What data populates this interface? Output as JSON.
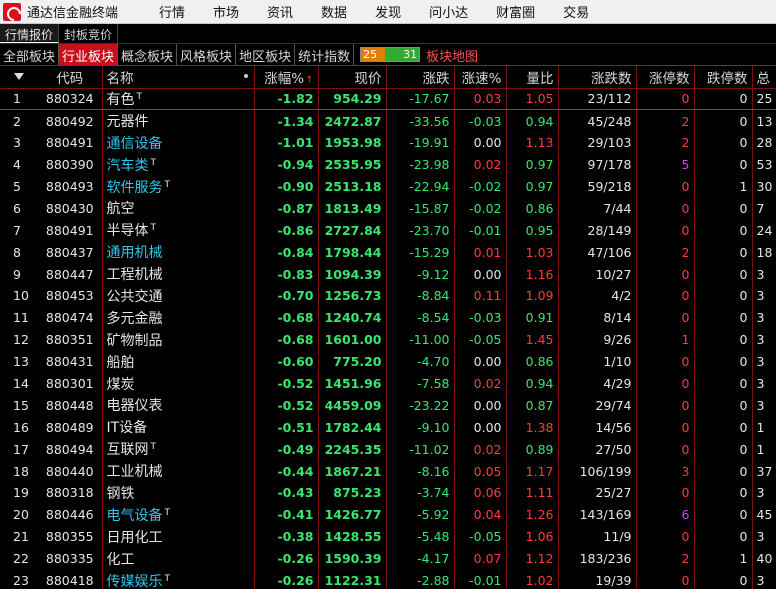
{
  "app": {
    "title": "通达信金融终端"
  },
  "menu": [
    "行情",
    "市场",
    "资讯",
    "数据",
    "发现",
    "问小达",
    "财富圈",
    "交易"
  ],
  "subtabs": [
    "行情报价",
    "封板竞价"
  ],
  "category_tabs": [
    "全部板块",
    "行业板块",
    "概念板块",
    "风格板块",
    "地区板块",
    "统计指数"
  ],
  "breadth": {
    "up": "25",
    "down": "31"
  },
  "map_button": "板块地图",
  "columns": {
    "code": "代码",
    "name": "名称",
    "pct": "涨幅%",
    "price": "现价",
    "chg": "涨跌",
    "speed": "涨速%",
    "ratio": "量比",
    "updown": "涨跌数",
    "limitup": "涨停数",
    "limitdown": "跌停数",
    "extra": "总"
  },
  "rows": [
    {
      "idx": "1",
      "code": "880324",
      "name": "有色",
      "tag": "T",
      "link": false,
      "pct": "-1.82",
      "price": "954.29",
      "chg": "-17.67",
      "speed": "0.03",
      "ratio": "1.05",
      "updown": "23/112",
      "limitup": "0",
      "limitdown": "0",
      "extra": "25"
    },
    {
      "idx": "2",
      "code": "880492",
      "name": "元器件",
      "tag": "",
      "link": false,
      "pct": "-1.34",
      "price": "2472.87",
      "chg": "-33.56",
      "speed": "-0.03",
      "ratio": "0.94",
      "updown": "45/248",
      "limitup": "2",
      "limitdown": "0",
      "extra": "13"
    },
    {
      "idx": "3",
      "code": "880491",
      "name": "通信设备",
      "tag": "",
      "link": true,
      "pct": "-1.01",
      "price": "1953.98",
      "chg": "-19.91",
      "speed": "0.00",
      "ratio": "1.13",
      "updown": "29/103",
      "limitup": "2",
      "limitdown": "0",
      "extra": "28"
    },
    {
      "idx": "4",
      "code": "880390",
      "name": "汽车类",
      "tag": "T",
      "link": true,
      "pct": "-0.94",
      "price": "2535.95",
      "chg": "-23.98",
      "speed": "0.02",
      "ratio": "0.97",
      "updown": "97/178",
      "limitup": "5",
      "limitdown": "0",
      "extra": "53"
    },
    {
      "idx": "5",
      "code": "880493",
      "name": "软件服务",
      "tag": "T",
      "link": true,
      "pct": "-0.90",
      "price": "2513.18",
      "chg": "-22.94",
      "speed": "-0.02",
      "ratio": "0.97",
      "updown": "59/218",
      "limitup": "0",
      "limitdown": "1",
      "extra": "30"
    },
    {
      "idx": "6",
      "code": "880430",
      "name": "航空",
      "tag": "",
      "link": false,
      "pct": "-0.87",
      "price": "1813.49",
      "chg": "-15.87",
      "speed": "-0.02",
      "ratio": "0.86",
      "updown": "7/44",
      "limitup": "0",
      "limitdown": "0",
      "extra": "7"
    },
    {
      "idx": "7",
      "code": "880491",
      "name": "半导体",
      "tag": "T",
      "link": false,
      "pct": "-0.86",
      "price": "2727.84",
      "chg": "-23.70",
      "speed": "-0.01",
      "ratio": "0.95",
      "updown": "28/149",
      "limitup": "0",
      "limitdown": "0",
      "extra": "24"
    },
    {
      "idx": "8",
      "code": "880437",
      "name": "通用机械",
      "tag": "",
      "link": true,
      "pct": "-0.84",
      "price": "1798.44",
      "chg": "-15.29",
      "speed": "0.01",
      "ratio": "1.03",
      "updown": "47/106",
      "limitup": "2",
      "limitdown": "0",
      "extra": "18"
    },
    {
      "idx": "9",
      "code": "880447",
      "name": "工程机械",
      "tag": "",
      "link": false,
      "pct": "-0.83",
      "price": "1094.39",
      "chg": "-9.12",
      "speed": "0.00",
      "ratio": "1.16",
      "updown": "10/27",
      "limitup": "0",
      "limitdown": "0",
      "extra": "3"
    },
    {
      "idx": "10",
      "code": "880453",
      "name": "公共交通",
      "tag": "",
      "link": false,
      "pct": "-0.70",
      "price": "1256.73",
      "chg": "-8.84",
      "speed": "0.11",
      "ratio": "1.09",
      "updown": "4/2",
      "limitup": "0",
      "limitdown": "0",
      "extra": "3"
    },
    {
      "idx": "11",
      "code": "880474",
      "name": "多元金融",
      "tag": "",
      "link": false,
      "pct": "-0.68",
      "price": "1240.74",
      "chg": "-8.54",
      "speed": "-0.03",
      "ratio": "0.91",
      "updown": "8/14",
      "limitup": "0",
      "limitdown": "0",
      "extra": "3"
    },
    {
      "idx": "12",
      "code": "880351",
      "name": "矿物制品",
      "tag": "",
      "link": false,
      "pct": "-0.68",
      "price": "1601.00",
      "chg": "-11.00",
      "speed": "-0.05",
      "ratio": "1.45",
      "updown": "9/26",
      "limitup": "1",
      "limitdown": "0",
      "extra": "3"
    },
    {
      "idx": "13",
      "code": "880431",
      "name": "船舶",
      "tag": "",
      "link": false,
      "pct": "-0.60",
      "price": "775.20",
      "chg": "-4.70",
      "speed": "0.00",
      "ratio": "0.86",
      "updown": "1/10",
      "limitup": "0",
      "limitdown": "0",
      "extra": "3"
    },
    {
      "idx": "14",
      "code": "880301",
      "name": "煤炭",
      "tag": "",
      "link": false,
      "pct": "-0.52",
      "price": "1451.96",
      "chg": "-7.58",
      "speed": "0.02",
      "ratio": "0.94",
      "updown": "4/29",
      "limitup": "0",
      "limitdown": "0",
      "extra": "3"
    },
    {
      "idx": "15",
      "code": "880448",
      "name": "电器仪表",
      "tag": "",
      "link": false,
      "pct": "-0.52",
      "price": "4459.09",
      "chg": "-23.22",
      "speed": "0.00",
      "ratio": "0.87",
      "updown": "29/74",
      "limitup": "0",
      "limitdown": "0",
      "extra": "3"
    },
    {
      "idx": "16",
      "code": "880489",
      "name": "IT设备",
      "tag": "",
      "link": false,
      "pct": "-0.51",
      "price": "1782.44",
      "chg": "-9.10",
      "speed": "0.00",
      "ratio": "1.38",
      "updown": "14/56",
      "limitup": "0",
      "limitdown": "0",
      "extra": "1"
    },
    {
      "idx": "17",
      "code": "880494",
      "name": "互联网",
      "tag": "T",
      "link": false,
      "pct": "-0.49",
      "price": "2245.35",
      "chg": "-11.02",
      "speed": "0.02",
      "ratio": "0.89",
      "updown": "27/50",
      "limitup": "0",
      "limitdown": "0",
      "extra": "1"
    },
    {
      "idx": "18",
      "code": "880440",
      "name": "工业机械",
      "tag": "",
      "link": false,
      "pct": "-0.44",
      "price": "1867.21",
      "chg": "-8.16",
      "speed": "0.05",
      "ratio": "1.17",
      "updown": "106/199",
      "limitup": "3",
      "limitdown": "0",
      "extra": "37"
    },
    {
      "idx": "19",
      "code": "880318",
      "name": "钢铁",
      "tag": "",
      "link": false,
      "pct": "-0.43",
      "price": "875.23",
      "chg": "-3.74",
      "speed": "0.06",
      "ratio": "1.11",
      "updown": "25/27",
      "limitup": "0",
      "limitdown": "0",
      "extra": "3"
    },
    {
      "idx": "20",
      "code": "880446",
      "name": "电气设备",
      "tag": "T",
      "link": true,
      "pct": "-0.41",
      "price": "1426.77",
      "chg": "-5.92",
      "speed": "0.04",
      "ratio": "1.26",
      "updown": "143/169",
      "limitup": "6",
      "limitdown": "0",
      "extra": "45"
    },
    {
      "idx": "21",
      "code": "880355",
      "name": "日用化工",
      "tag": "",
      "link": false,
      "pct": "-0.38",
      "price": "1428.55",
      "chg": "-5.48",
      "speed": "-0.05",
      "ratio": "1.06",
      "updown": "11/9",
      "limitup": "0",
      "limitdown": "0",
      "extra": "3"
    },
    {
      "idx": "22",
      "code": "880335",
      "name": "化工",
      "tag": "",
      "link": false,
      "pct": "-0.26",
      "price": "1590.39",
      "chg": "-4.17",
      "speed": "0.07",
      "ratio": "1.12",
      "updown": "183/236",
      "limitup": "2",
      "limitdown": "1",
      "extra": "40"
    },
    {
      "idx": "23",
      "code": "880418",
      "name": "传媒娱乐",
      "tag": "T",
      "link": true,
      "pct": "-0.26",
      "price": "1122.31",
      "chg": "-2.88",
      "speed": "-0.01",
      "ratio": "1.02",
      "updown": "19/39",
      "limitup": "0",
      "limitdown": "0",
      "extra": "3"
    }
  ]
}
